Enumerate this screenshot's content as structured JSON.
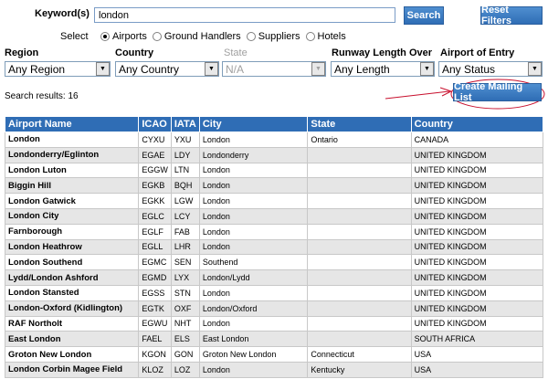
{
  "search": {
    "keyword_label": "Keyword(s)",
    "keyword_value": "london",
    "search_label": "Search",
    "reset_label": "Reset Filters",
    "select_label": "Select",
    "types": [
      "Airports",
      "Ground Handlers",
      "Suppliers",
      "Hotels"
    ],
    "selected_type_index": 0
  },
  "filters": {
    "region": {
      "label": "Region",
      "value": "Any Region"
    },
    "country": {
      "label": "Country",
      "value": "Any Country"
    },
    "state": {
      "label": "State",
      "value": "N/A"
    },
    "runway": {
      "label": "Runway Length Over",
      "value": "Any Length"
    },
    "entry": {
      "label": "Airport of Entry",
      "value": "Any Status"
    }
  },
  "results": {
    "count_text": "Search results: 16",
    "mailing_label": "Create Mailing List",
    "columns": [
      "Airport Name",
      "ICAO",
      "IATA",
      "City",
      "State",
      "Country"
    ],
    "rows": [
      [
        "London",
        "CYXU",
        "YXU",
        "London",
        "Ontario",
        "CANADA"
      ],
      [
        "Londonderry/Eglinton",
        "EGAE",
        "LDY",
        "Londonderry",
        "",
        "UNITED KINGDOM"
      ],
      [
        "London Luton",
        "EGGW",
        "LTN",
        "London",
        "",
        "UNITED KINGDOM"
      ],
      [
        "Biggin Hill",
        "EGKB",
        "BQH",
        "London",
        "",
        "UNITED KINGDOM"
      ],
      [
        "London Gatwick",
        "EGKK",
        "LGW",
        "London",
        "",
        "UNITED KINGDOM"
      ],
      [
        "London City",
        "EGLC",
        "LCY",
        "London",
        "",
        "UNITED KINGDOM"
      ],
      [
        "Farnborough",
        "EGLF",
        "FAB",
        "London",
        "",
        "UNITED KINGDOM"
      ],
      [
        "London Heathrow",
        "EGLL",
        "LHR",
        "London",
        "",
        "UNITED KINGDOM"
      ],
      [
        "London Southend",
        "EGMC",
        "SEN",
        "Southend",
        "",
        "UNITED KINGDOM"
      ],
      [
        "Lydd/London Ashford",
        "EGMD",
        "LYX",
        "London/Lydd",
        "",
        "UNITED KINGDOM"
      ],
      [
        "London Stansted",
        "EGSS",
        "STN",
        "London",
        "",
        "UNITED KINGDOM"
      ],
      [
        "London-Oxford (Kidlington)",
        "EGTK",
        "OXF",
        "London/Oxford",
        "",
        "UNITED KINGDOM"
      ],
      [
        "RAF Northolt",
        "EGWU",
        "NHT",
        "London",
        "",
        "UNITED KINGDOM"
      ],
      [
        "East London",
        "FAEL",
        "ELS",
        "East London",
        "",
        "SOUTH AFRICA"
      ],
      [
        "Groton New London",
        "KGON",
        "GON",
        "Groton New London",
        "Connecticut",
        "USA"
      ],
      [
        "London Corbin Magee Field",
        "KLOZ",
        "LOZ",
        "London",
        "Kentucky",
        "USA"
      ]
    ]
  },
  "colors": {
    "header_blue": "#2f6db5",
    "annotation_red": "#c8102e"
  }
}
